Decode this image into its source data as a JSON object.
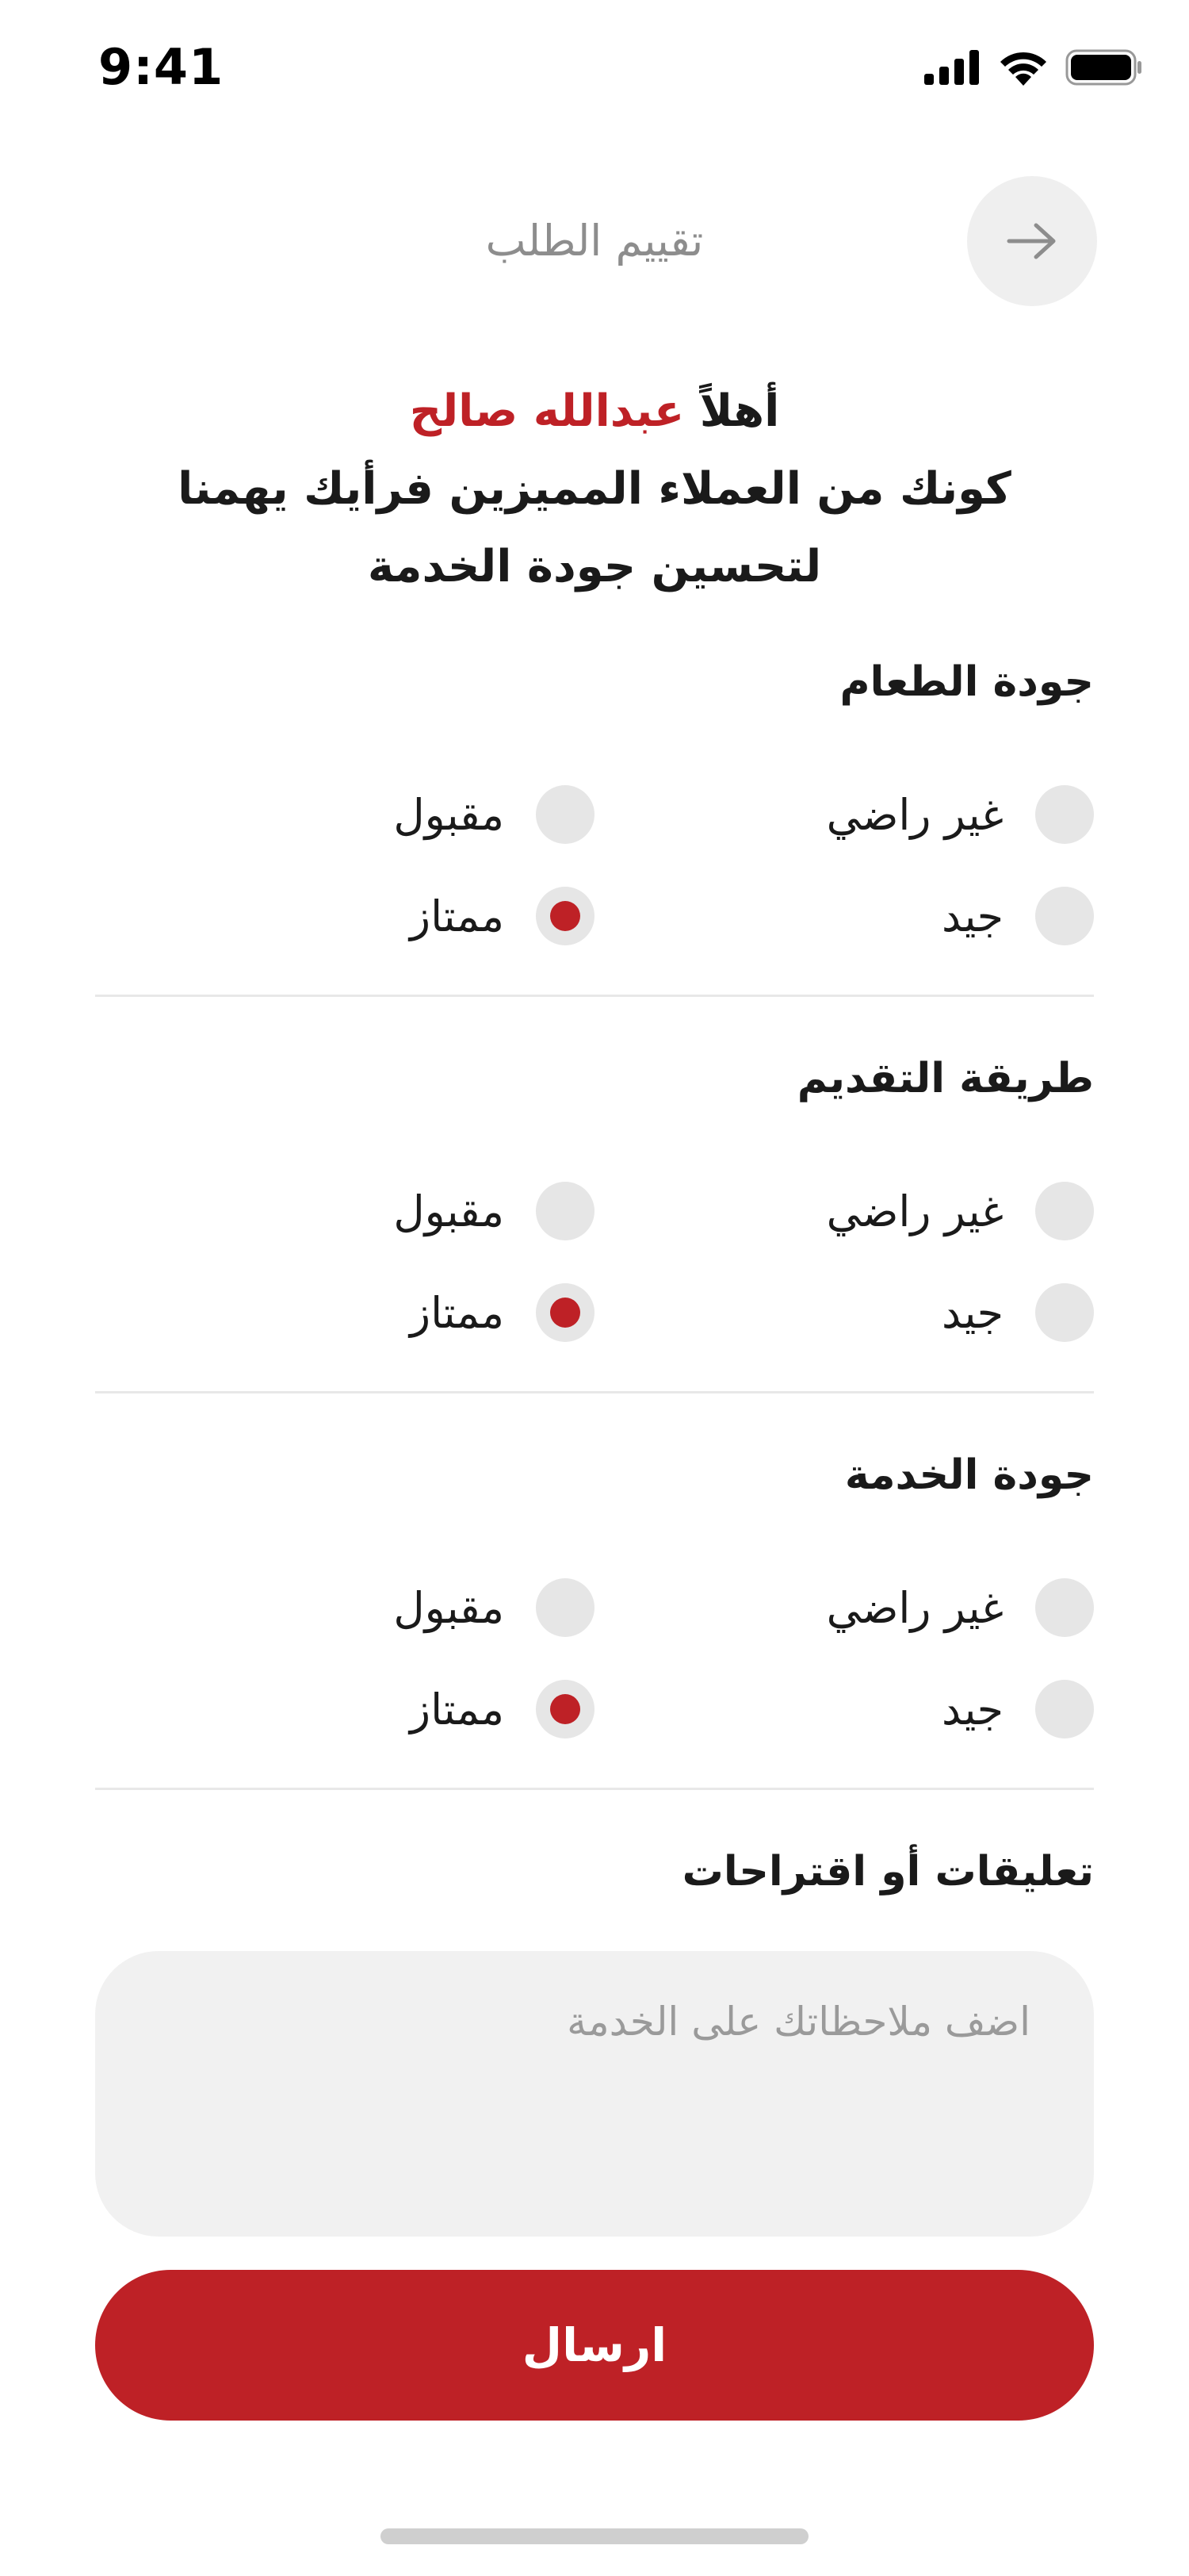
{
  "status_bar": {
    "time": "9:41",
    "icons": [
      "cellular-signal-icon",
      "wifi-icon",
      "battery-icon"
    ]
  },
  "header": {
    "title": "تقييم الطلب",
    "back_icon": "arrow-right-icon"
  },
  "greeting": {
    "hello": "أهلاً",
    "name": "عبدالله صالح",
    "line2": "كونك من العملاء المميزين فرأيك يهمنا",
    "line3": "لتحسين جودة الخدمة"
  },
  "sections": [
    {
      "title": "جودة الطعام",
      "options": [
        "غير راضي",
        "مقبول",
        "جيد",
        "ممتاز"
      ],
      "selected": "ممتاز"
    },
    {
      "title": "طريقة التقديم",
      "options": [
        "غير راضي",
        "مقبول",
        "جيد",
        "ممتاز"
      ],
      "selected": "ممتاز"
    },
    {
      "title": "جودة الخدمة",
      "options": [
        "غير راضي",
        "مقبول",
        "جيد",
        "ممتاز"
      ],
      "selected": "ممتاز"
    }
  ],
  "comments": {
    "title": "تعليقات أو اقتراحات",
    "placeholder": "اضف ملاحظاتك على الخدمة",
    "value": ""
  },
  "submit": {
    "label": "ارسال"
  },
  "colors": {
    "accent": "#be2126",
    "radio_off": "#e6e6e6",
    "field_bg": "#f1f1f1",
    "muted_text": "#8d8d8d"
  }
}
